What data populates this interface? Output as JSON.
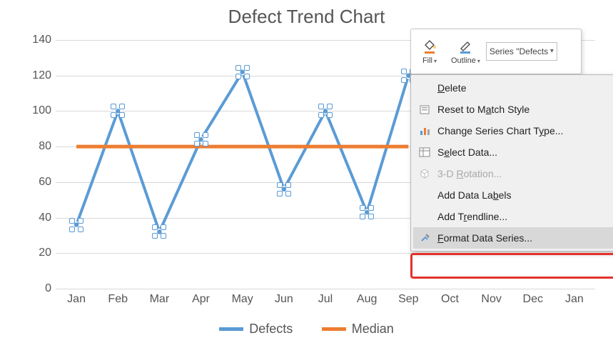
{
  "chart_data": {
    "type": "line",
    "title": "Defect Trend Chart",
    "categories": [
      "Jan",
      "Feb",
      "Mar",
      "Apr",
      "May",
      "Jun",
      "Jul",
      "Aug",
      "Sep",
      "Oct",
      "Nov",
      "Dec",
      "Jan"
    ],
    "series": [
      {
        "name": "Defects",
        "color": "#5B9BD5",
        "values": [
          36,
          100,
          32,
          84,
          122,
          56,
          100,
          43,
          120,
          null,
          null,
          null,
          null
        ]
      },
      {
        "name": "Median",
        "color": "#ED7D31",
        "values": [
          80,
          80,
          80,
          80,
          80,
          80,
          80,
          80,
          80,
          null,
          null,
          null,
          null
        ]
      }
    ],
    "ylim": [
      0,
      140
    ],
    "ytick": 20,
    "xlabel": "",
    "ylabel": ""
  },
  "legend": [
    {
      "label": "Defects",
      "color": "#5B9BD5"
    },
    {
      "label": "Median",
      "color": "#ED7D31"
    }
  ],
  "mini_toolbar": {
    "fill": {
      "label": "Fill",
      "swatch": "#ED7D31"
    },
    "outline": {
      "label": "Outline",
      "swatch": "#5B9BD5"
    },
    "series_select": "Series \"Defects"
  },
  "context_menu": {
    "items": [
      {
        "id": "delete",
        "label_pre": "",
        "mnemonic": "D",
        "label_post": "elete",
        "icon": null,
        "disabled": false
      },
      {
        "id": "reset",
        "label_pre": "Reset to M",
        "mnemonic": "a",
        "label_post": "tch Style",
        "icon": "reset-icon",
        "disabled": false
      },
      {
        "id": "change-type",
        "label_pre": "Change Series Chart T",
        "mnemonic": "y",
        "label_post": "pe...",
        "icon": "bar-chart-icon",
        "disabled": false
      },
      {
        "id": "select-data",
        "label_pre": "S",
        "mnemonic": "e",
        "label_post": "lect Data...",
        "icon": "select-data-icon",
        "disabled": false
      },
      {
        "id": "rotation3d",
        "label_pre": "3-D ",
        "mnemonic": "R",
        "label_post": "otation...",
        "icon": "cube-icon",
        "disabled": true
      },
      {
        "id": "data-labels",
        "label_pre": "Add Data La",
        "mnemonic": "b",
        "label_post": "els",
        "icon": null,
        "disabled": false,
        "submenu": true
      },
      {
        "id": "trendline",
        "label_pre": "Add T",
        "mnemonic": "r",
        "label_post": "endline...",
        "icon": null,
        "disabled": false
      },
      {
        "id": "format-series",
        "label_pre": "",
        "mnemonic": "F",
        "label_post": "ormat Data Series...",
        "icon": "format-series-icon",
        "disabled": false,
        "highlighted": true
      }
    ]
  }
}
